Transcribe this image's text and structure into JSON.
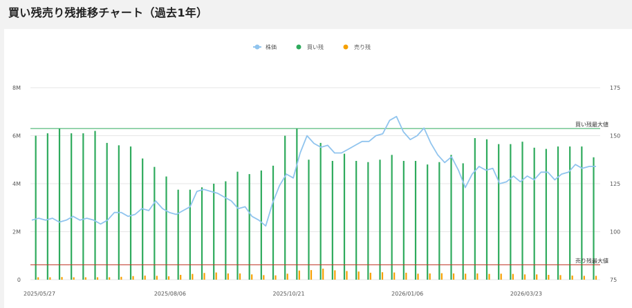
{
  "page": {
    "title": "買い残売り残推移チャート（過去1年）"
  },
  "chart_data": {
    "type": "bar+line",
    "legend": [
      {
        "name": "株価",
        "color": "#90c4ee",
        "icon": "line-dot-icon"
      },
      {
        "name": "買い残",
        "color": "#2eaa5c",
        "icon": "dot-icon"
      },
      {
        "name": "売り残",
        "color": "#f5a000",
        "icon": "dot-icon"
      }
    ],
    "legend_position": "top-center",
    "grid": true,
    "x_tick_labels": [
      "2025/05/27",
      "2025/08/06",
      "2025/10/21",
      "2026/01/06",
      "2026/03/23"
    ],
    "x_tick_index": [
      0,
      11,
      21,
      31,
      41
    ],
    "x_count": 48,
    "y_left": {
      "ticks": [
        "0",
        "2M",
        "4M",
        "6M",
        "8M"
      ],
      "tick_values": [
        0,
        2000000,
        4000000,
        6000000,
        8000000
      ],
      "range": [
        0,
        8000000
      ]
    },
    "y_right": {
      "ticks": [
        "75",
        "100",
        "125",
        "150",
        "175"
      ],
      "tick_values": [
        75,
        100,
        125,
        150,
        175
      ],
      "range": [
        75,
        175
      ]
    },
    "reference_lines": [
      {
        "label": "買い残最大値",
        "value": 6300000,
        "color": "#2eaa5c"
      },
      {
        "label": "売り残最大値",
        "value": 620000,
        "color": "#c0392b"
      }
    ],
    "series": [
      {
        "name": "買い残",
        "axis": "left",
        "color": "#2eaa5c",
        "values": [
          6000000,
          6100000,
          6300000,
          6100000,
          6100000,
          6200000,
          5700000,
          5600000,
          5550000,
          5050000,
          4700000,
          4300000,
          3750000,
          3750000,
          3850000,
          4000000,
          4100000,
          4500000,
          4400000,
          4550000,
          4750000,
          6000000,
          6300000,
          5000000,
          5700000,
          4950000,
          5250000,
          4950000,
          4900000,
          5000000,
          5200000,
          4950000,
          4950000,
          4800000,
          4900000,
          5200000,
          4850000,
          5900000,
          5850000,
          5650000,
          5650000,
          5750000,
          5500000,
          5450000,
          5550000,
          5550000,
          5550000,
          5100000
        ]
      },
      {
        "name": "売り残",
        "axis": "left",
        "color": "#f5a000",
        "values": [
          100000,
          100000,
          110000,
          100000,
          100000,
          100000,
          100000,
          120000,
          150000,
          170000,
          160000,
          140000,
          200000,
          240000,
          280000,
          300000,
          260000,
          260000,
          220000,
          190000,
          180000,
          250000,
          380000,
          400000,
          460000,
          390000,
          360000,
          340000,
          290000,
          310000,
          300000,
          290000,
          250000,
          260000,
          270000,
          260000,
          250000,
          260000,
          240000,
          250000,
          240000,
          220000,
          220000,
          200000,
          190000,
          170000,
          160000,
          160000
        ]
      },
      {
        "name": "株価",
        "axis": "right",
        "color": "#90c4ee",
        "values": [
          106,
          107,
          106,
          107,
          105,
          106,
          108,
          106,
          107,
          106,
          104,
          106,
          110,
          110,
          108,
          109,
          112,
          111,
          116,
          112,
          110,
          109,
          111,
          113,
          121,
          122,
          121,
          120,
          118,
          116,
          112,
          113,
          108,
          106,
          103,
          115,
          124,
          130,
          128,
          141,
          150,
          146,
          144,
          145,
          141,
          141,
          143,
          145,
          147,
          147,
          150,
          151,
          158,
          160,
          152,
          148,
          150,
          154,
          146,
          140,
          136,
          139,
          132,
          123,
          130,
          134,
          132,
          133,
          125,
          126,
          129,
          126,
          129,
          127,
          131,
          131,
          127,
          130,
          131,
          135,
          133,
          134,
          134
        ]
      }
    ]
  }
}
